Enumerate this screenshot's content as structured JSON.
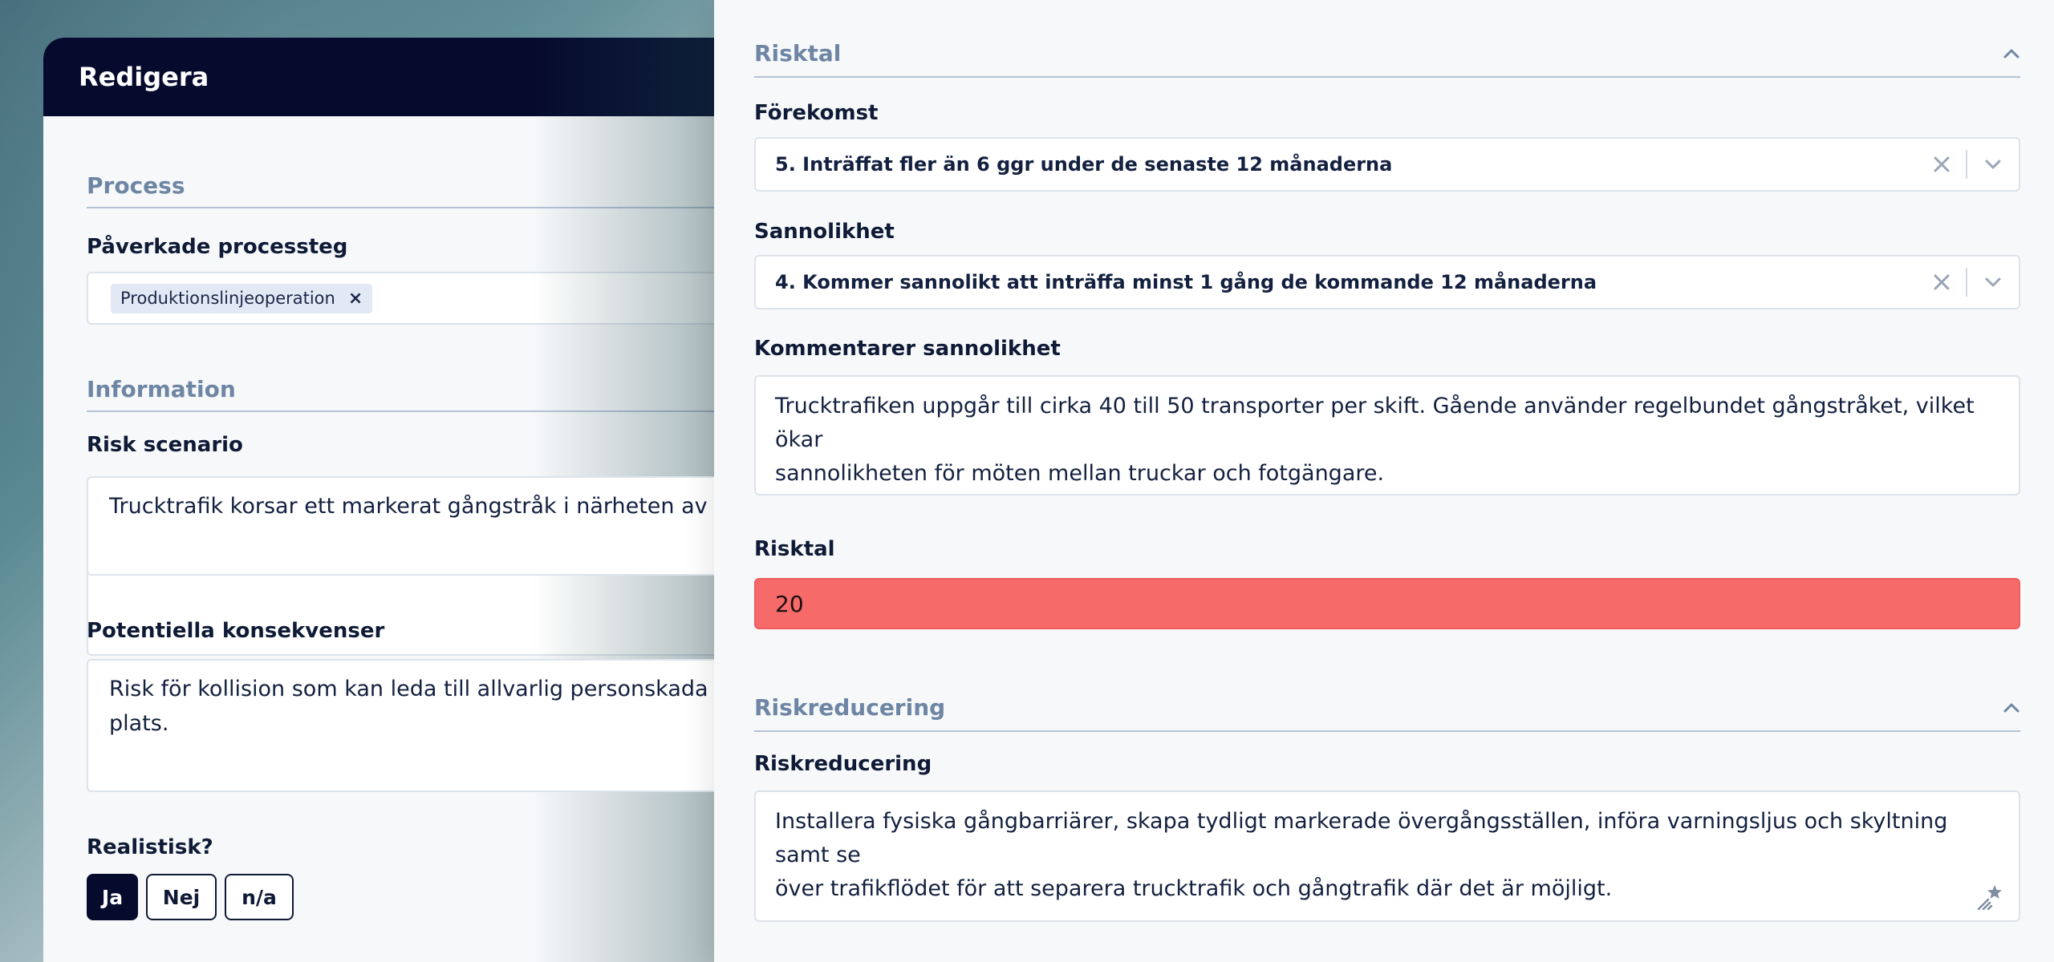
{
  "modal": {
    "title": "Redigera",
    "process_section": "Process",
    "affected_steps_label": "Påverkade processteg",
    "affected_steps_tags": [
      "Produktionslinjeoperation"
    ],
    "information_section": "Information",
    "risk_scenario_label": "Risk scenario",
    "risk_scenario_value": "Trucktrafik korsar ett markerat gångstråk i närheten av p",
    "consequences_label": "Potentiella konsekvenser",
    "consequences_line1": "Risk för kollision som kan leda till allvarlig personskada o",
    "consequences_line2": "plats.",
    "realistic_label": "Realistisk?",
    "realistic_options": [
      "Ja",
      "Nej",
      "n/a"
    ],
    "realistic_selected": "Ja"
  },
  "panel": {
    "risktal_section": "Risktal",
    "occurrence_label": "Förekomst",
    "occurrence_value": "5. Inträffat fler än 6 ggr under de senaste 12 månaderna",
    "probability_label": "Sannolikhet",
    "probability_value": "4. Kommer sannolikt att inträffa minst 1 gång de kommande 12 månaderna",
    "probability_comment_label": "Kommentarer sannolikhet",
    "probability_comment_line1": "Trucktrafiken uppgår till cirka 40 till 50 transporter per skift. Gående använder regelbundet gångstråket, vilket ökar",
    "probability_comment_line2": "sannolikheten för möten mellan truckar och fotgängare.",
    "risk_score_label": "Risktal",
    "risk_score_value": "20",
    "risk_score_color": "#f66a6a",
    "reduction_section": "Riskreducering",
    "reduction_label": "Riskreducering",
    "reduction_line1": "Installera fysiska gångbarriärer, skapa tydligt markerade övergångsställen, införa varningsljus och skyltning samt se",
    "reduction_line2": "över trafikflödet för att separera trucktrafik och gångtrafik där det är möjligt."
  },
  "icons": {
    "collapse": "chevron-up-icon",
    "clear": "close-icon",
    "dropdown": "chevron-down-icon",
    "tag_remove": "close-icon",
    "resize": "magic-resize-icon"
  }
}
